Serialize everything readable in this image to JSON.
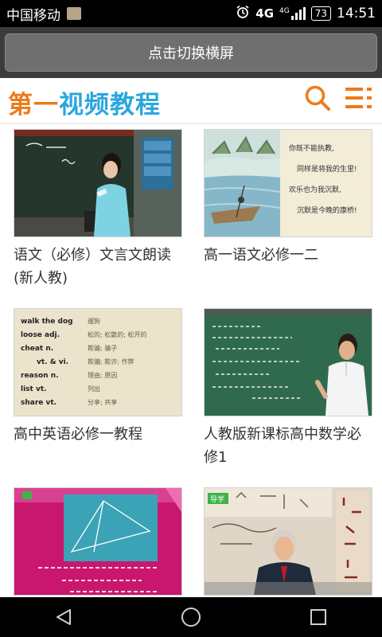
{
  "status_bar": {
    "carrier": "中国移动",
    "network": "4G",
    "network_small": "4G",
    "battery": "73",
    "time": "14:51"
  },
  "toolbar": {
    "rotate_label": "点击切换横屏"
  },
  "brand": {
    "part1": "第一",
    "part2": "视频教程",
    "accent_orange": "#ee7a1b",
    "accent_blue": "#2aa7de"
  },
  "videos": [
    {
      "title": "语文（必修）文言文朗读(新人教)"
    },
    {
      "title": "高一语文必修一二"
    },
    {
      "title": "高中英语必修一教程"
    },
    {
      "title": "人教版新课标高中数学必修1"
    },
    {
      "title": ""
    },
    {
      "title": ""
    }
  ],
  "thumb_text": {
    "english_words": [
      "walk the dog",
      "loose adj.",
      "cheat n.",
      "vt. & vi.",
      "reason n.",
      "list vt.",
      "share vt."
    ],
    "english_gloss": [
      "遛狗",
      "松的; 松散的; 松开的",
      "欺骗; 骗子",
      "欺骗; 欺诈; 作弊",
      "理由; 原因",
      "列出",
      "分享; 共享"
    ],
    "poem_lines": [
      "你既不能执教,",
      "同样是将我的生里!",
      "欢乐也为我沉默,",
      "沉默是今晚的康桥!"
    ],
    "tag": "导学"
  }
}
